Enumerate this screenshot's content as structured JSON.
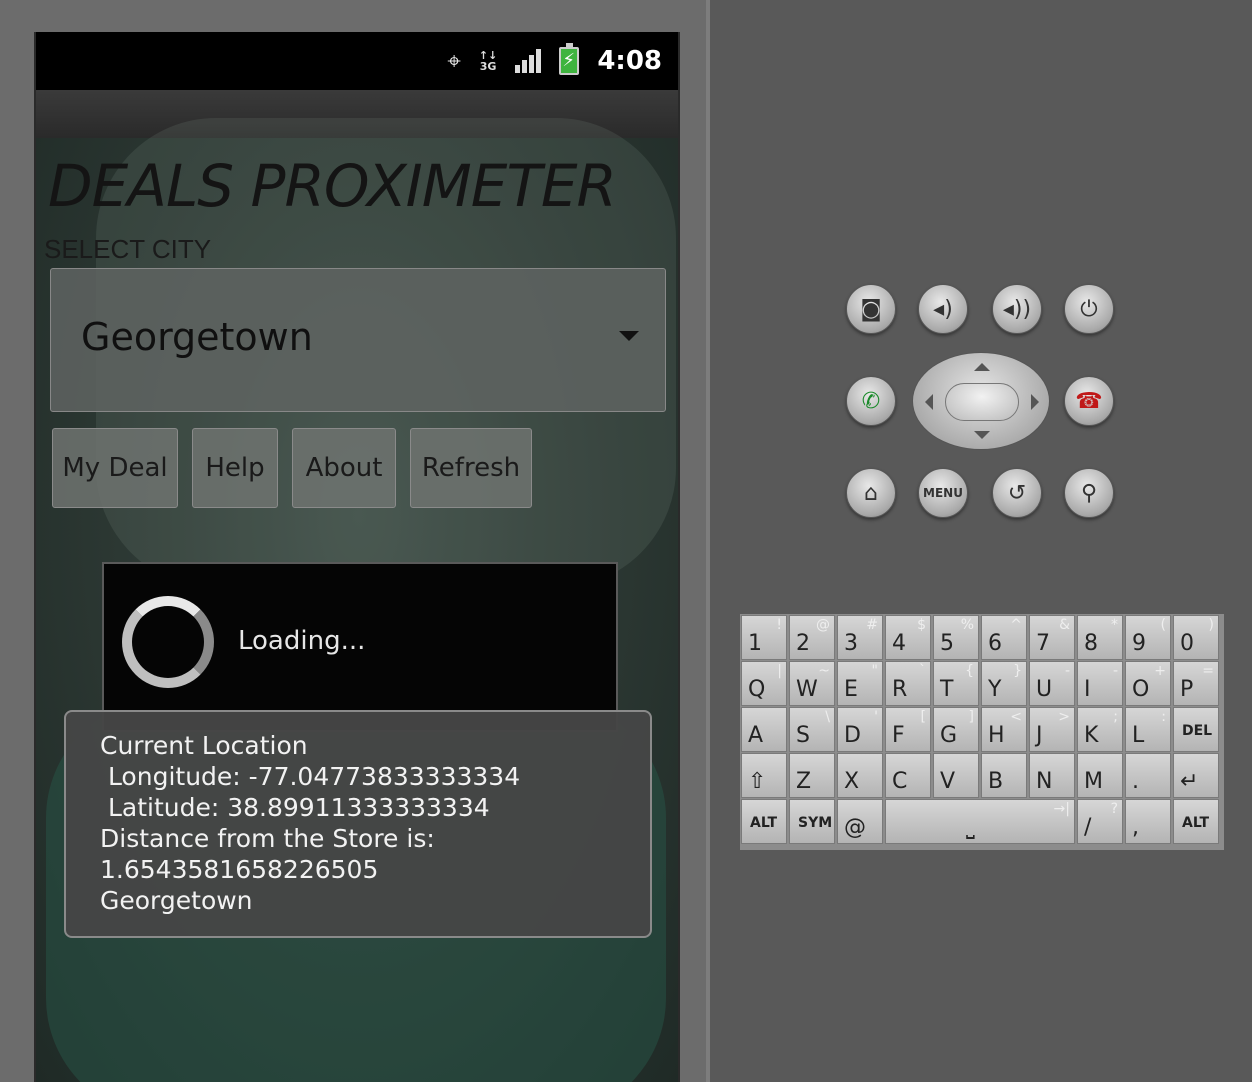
{
  "status_bar": {
    "gps_icon": "gps-icon",
    "network_label_top": "↑↓",
    "network_label_bottom": "3G",
    "signal_icon": "signal-bars-icon",
    "battery_icon": "battery-charging-icon",
    "time": "4:08"
  },
  "app": {
    "title": "DEALS PROXIMETER",
    "select_label": "SELECT CITY",
    "city_spinner": {
      "selected": "Georgetown"
    },
    "buttons": {
      "my_deal": "My Deal",
      "help": "Help",
      "about": "About",
      "refresh": "Refresh"
    }
  },
  "loading_dialog": {
    "text": "Loading..."
  },
  "toast": {
    "line1": "Current Location",
    "line2": " Longitude: -77.04773833333334",
    "line3": " Latitude: 38.89911333333334",
    "line4": "Distance from the Store is:",
    "line5": "1.6543581658226505",
    "line6": "Georgetown"
  },
  "hardware_buttons": {
    "camera": "camera-icon",
    "volume_down": "volume-down-icon",
    "volume_up": "volume-up-icon",
    "power": "power-icon",
    "call": "call-icon",
    "end_call": "end-call-icon",
    "home": "home-icon",
    "menu": "MENU",
    "back": "back-icon",
    "search": "search-icon"
  },
  "keyboard": {
    "row1": [
      {
        "m": "1",
        "a": "!"
      },
      {
        "m": "2",
        "a": "@"
      },
      {
        "m": "3",
        "a": "#"
      },
      {
        "m": "4",
        "a": "$"
      },
      {
        "m": "5",
        "a": "%"
      },
      {
        "m": "6",
        "a": "^"
      },
      {
        "m": "7",
        "a": "&"
      },
      {
        "m": "8",
        "a": "*"
      },
      {
        "m": "9",
        "a": "("
      },
      {
        "m": "0",
        "a": ")"
      }
    ],
    "row2": [
      {
        "m": "Q",
        "a": "|"
      },
      {
        "m": "W",
        "a": "~"
      },
      {
        "m": "E",
        "a": "\""
      },
      {
        "m": "R",
        "a": "`"
      },
      {
        "m": "T",
        "a": "{"
      },
      {
        "m": "Y",
        "a": "}"
      },
      {
        "m": "U",
        "a": "-"
      },
      {
        "m": "I",
        "a": "-"
      },
      {
        "m": "O",
        "a": "+"
      },
      {
        "m": "P",
        "a": "="
      }
    ],
    "row3": [
      {
        "m": "A",
        "a": ""
      },
      {
        "m": "S",
        "a": "\\"
      },
      {
        "m": "D",
        "a": "'"
      },
      {
        "m": "F",
        "a": "["
      },
      {
        "m": "G",
        "a": "]"
      },
      {
        "m": "H",
        "a": "<"
      },
      {
        "m": "J",
        "a": ">"
      },
      {
        "m": "K",
        "a": ";"
      },
      {
        "m": "L",
        "a": ":"
      },
      {
        "m": "DEL",
        "a": ""
      }
    ],
    "row4": [
      {
        "m": "⇧",
        "a": ""
      },
      {
        "m": "Z",
        "a": ""
      },
      {
        "m": "X",
        "a": ""
      },
      {
        "m": "C",
        "a": ""
      },
      {
        "m": "V",
        "a": ""
      },
      {
        "m": "B",
        "a": ""
      },
      {
        "m": "N",
        "a": ""
      },
      {
        "m": "M",
        "a": ""
      },
      {
        "m": ".",
        "a": ""
      },
      {
        "m": "↵",
        "a": ""
      }
    ],
    "row5": [
      {
        "m": "ALT",
        "a": ""
      },
      {
        "m": "SYM",
        "a": ""
      },
      {
        "m": "@",
        "a": ""
      },
      {
        "m": "⎵",
        "a": "→|"
      },
      {
        "m": "/",
        "a": "?"
      },
      {
        "m": ",",
        "a": ""
      },
      {
        "m": "ALT",
        "a": ""
      }
    ]
  }
}
